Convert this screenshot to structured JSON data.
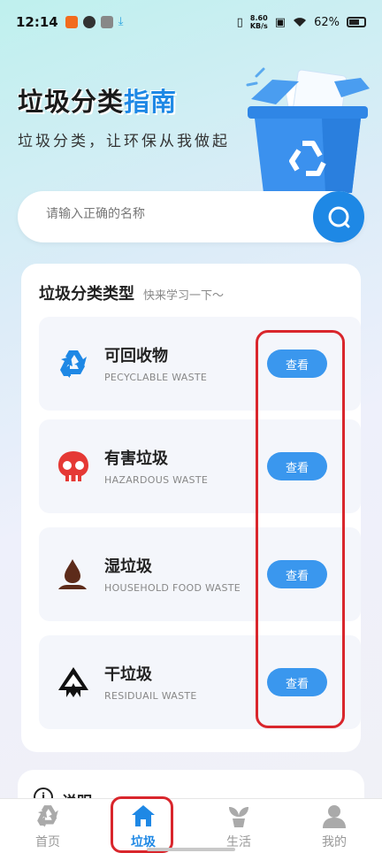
{
  "status": {
    "time": "12:14",
    "speed_value": "8.60",
    "speed_unit": "KB/s",
    "battery": "62%"
  },
  "hero": {
    "title_main": "垃圾分类",
    "title_highlight": "指南",
    "subtitle": "垃圾分类，让环保从我做起"
  },
  "search": {
    "placeholder": "请输入正确的名称"
  },
  "categories": {
    "title": "垃圾分类类型",
    "subtitle": "快来学习一下～",
    "items": [
      {
        "name": "可回收物",
        "en": "PECYCLABLE WASTE",
        "button": "查看",
        "icon": "recycle-icon",
        "color": "#1e88e5"
      },
      {
        "name": "有害垃圾",
        "en": "HAZARDOUS WASTE",
        "button": "查看",
        "icon": "skull-icon",
        "color": "#e53935"
      },
      {
        "name": "湿垃圾",
        "en": "HOUSEHOLD FOOD WASTE",
        "button": "查看",
        "icon": "drop-icon",
        "color": "#5d2b1a"
      },
      {
        "name": "干垃圾",
        "en": "RESIDUAIL WASTE",
        "button": "查看",
        "icon": "residual-icon",
        "color": "#111111"
      }
    ]
  },
  "notice": {
    "title": "说明"
  },
  "tabs": [
    {
      "label": "首页",
      "icon": "recycle-icon",
      "active": false
    },
    {
      "label": "垃圾",
      "icon": "home-icon",
      "active": true
    },
    {
      "label": "生活",
      "icon": "plant-icon",
      "active": false
    },
    {
      "label": "我的",
      "icon": "user-icon",
      "active": false
    }
  ],
  "colors": {
    "accent": "#1e88e5",
    "highlight_box": "#d9262c"
  }
}
